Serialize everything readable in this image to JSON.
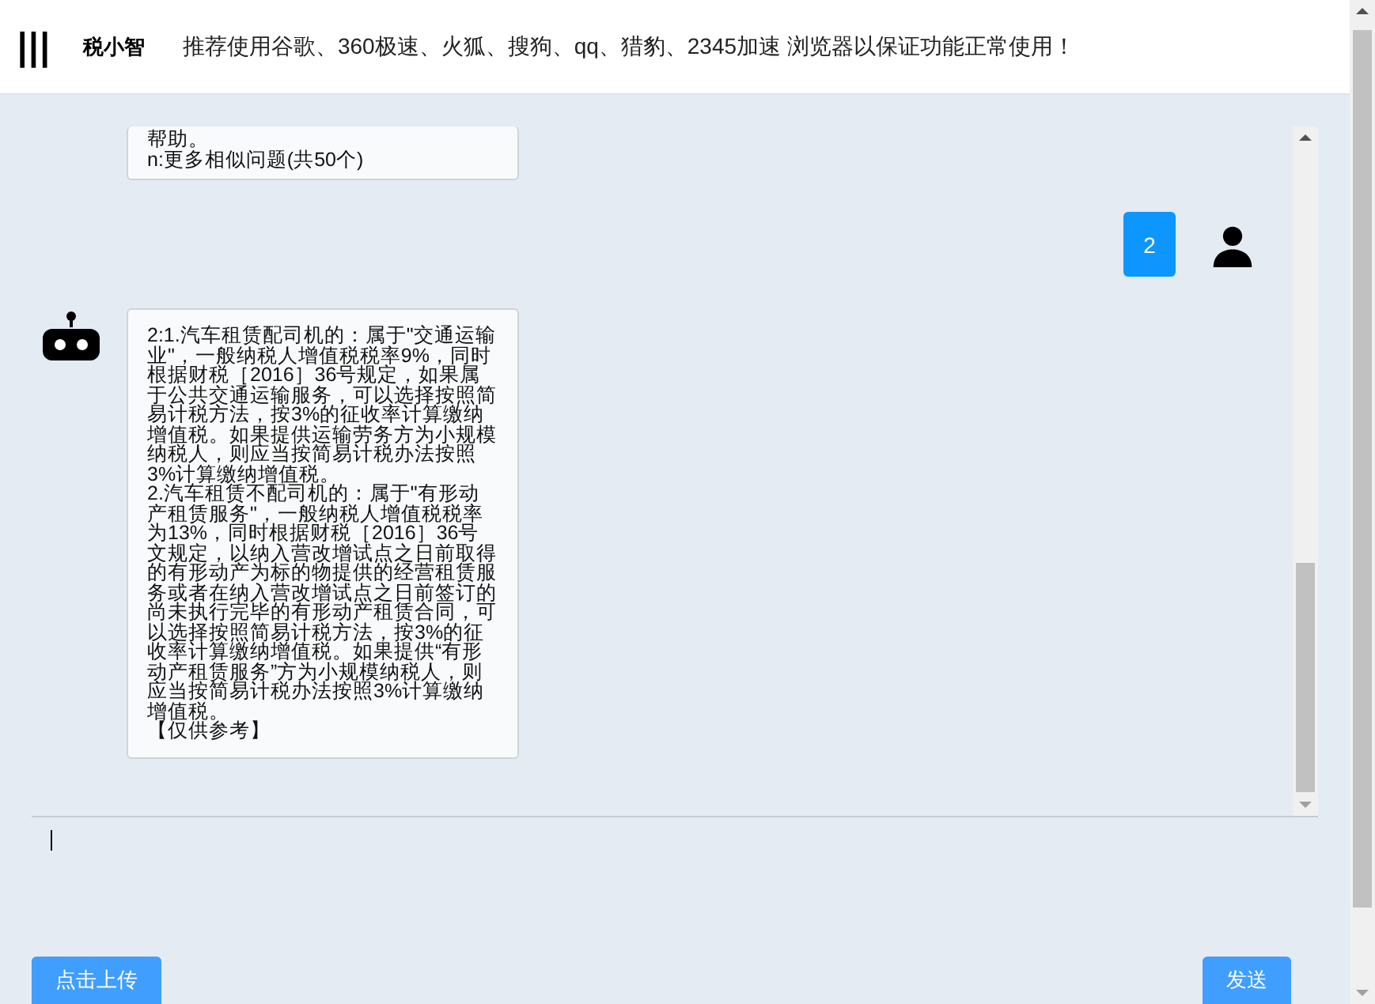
{
  "header": {
    "menu_icon": "|||",
    "title": "税小智",
    "notice": "推荐使用谷歌、360极速、火狐、搜狗、qq、猎豹、2345加速 浏览器以保证功能正常使用！"
  },
  "messages": [
    {
      "kind": "bot",
      "paragraphs": [
        "帮助。",
        "n:更多相似问题(共50个)"
      ]
    },
    {
      "kind": "user",
      "paragraphs": [
        "2"
      ]
    },
    {
      "kind": "bot",
      "paragraphs": [
        "2:1.汽车租赁配司机的：属于\"交通运输业\"，一般纳税人增值税税率9%，同时根据财税［2016］36号规定，如果属于公共交通运输服务，可以选择按照简易计税方法，按3%的征收率计算缴纳增值税。如果提供运输劳务方为小规模纳税人，则应当按简易计税办法按照3%计算缴纳增值税。",
        "2.汽车租赁不配司机的：属于\"有形动产租赁服务\"，一般纳税人增值税税率为13%，同时根据财税［2016］36号文规定，以纳入营改增试点之日前取得的有形动产为标的物提供的经营租赁服务或者在纳入营改增试点之日前签订的尚未执行完毕的有形动产租赁合同，可以选择按照简易计税方法，按3%的征收率计算缴纳增值税。如果提供“有形动产租赁服务”方为小规模纳税人，则应当按简易计税办法按照3%计算缴纳增值税。",
        "【仅供参考】"
      ]
    }
  ],
  "buttons": {
    "upload": "点击上传",
    "send": "发送"
  }
}
